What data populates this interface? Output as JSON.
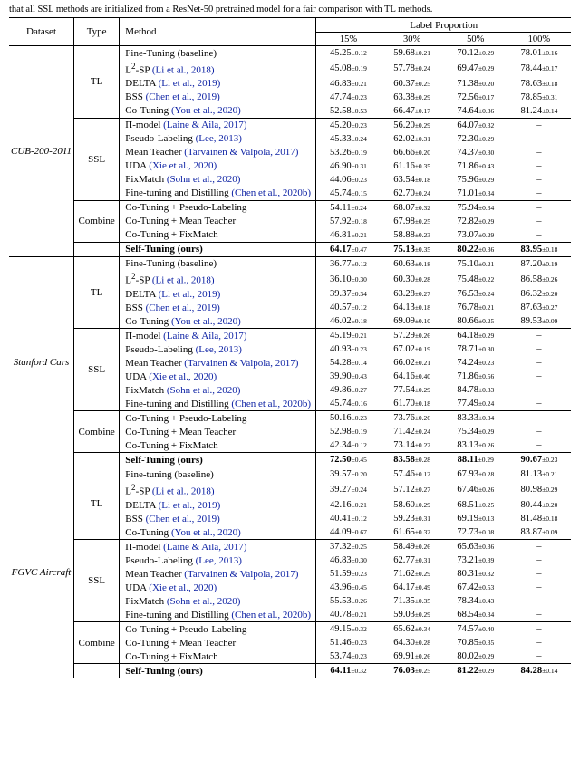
{
  "caption": "that all SSL methods are initialized from a ResNet-50 pretrained model for a fair comparison with TL methods.",
  "hdr": {
    "dataset": "Dataset",
    "type": "Type",
    "method": "Method",
    "lp": "Label Proportion",
    "p15": "15%",
    "p30": "30%",
    "p50": "50%",
    "p100": "100%"
  },
  "chart_data": {
    "type": "table",
    "datasets": [
      {
        "name": "CUB-200-2011",
        "groups": [
          {
            "type": "TL",
            "rows": [
              {
                "method": "Fine-Tuning (baseline)",
                "cite": "",
                "v": [
                  "45.25±0.12",
                  "59.68±0.21",
                  "70.12±0.29",
                  "78.01±0.16"
                ]
              },
              {
                "method": "L²-SP ",
                "cite": "(Li et al., 2018)",
                "v": [
                  "45.08±0.19",
                  "57.78±0.24",
                  "69.47±0.29",
                  "78.44±0.17"
                ]
              },
              {
                "method": "DELTA ",
                "cite": "(Li et al., 2019)",
                "v": [
                  "46.83±0.21",
                  "60.37±0.25",
                  "71.38±0.20",
                  "78.63±0.18"
                ]
              },
              {
                "method": "BSS ",
                "cite": "(Chen et al., 2019)",
                "v": [
                  "47.74±0.23",
                  "63.38±0.29",
                  "72.56±0.17",
                  "78.85±0.31"
                ]
              },
              {
                "method": "Co-Tuning ",
                "cite": "(You et al., 2020)",
                "v": [
                  "52.58±0.53",
                  "66.47±0.17",
                  "74.64±0.36",
                  "81.24±0.14"
                ]
              }
            ]
          },
          {
            "type": "SSL",
            "rows": [
              {
                "method": "Π-model ",
                "cite": "(Laine & Aila, 2017)",
                "v": [
                  "45.20±0.23",
                  "56.20±0.29",
                  "64.07±0.32",
                  "–"
                ]
              },
              {
                "method": "Pseudo-Labeling ",
                "cite": "(Lee, 2013)",
                "v": [
                  "45.33±0.24",
                  "62.02±0.31",
                  "72.30±0.29",
                  "–"
                ]
              },
              {
                "method": "Mean Teacher ",
                "cite": "(Tarvainen & Valpola, 2017)",
                "v": [
                  "53.26±0.19",
                  "66.66±0.20",
                  "74.37±0.30",
                  "–"
                ]
              },
              {
                "method": "UDA ",
                "cite": "(Xie et al., 2020)",
                "v": [
                  "46.90±0.31",
                  "61.16±0.35",
                  "71.86±0.43",
                  "–"
                ]
              },
              {
                "method": "FixMatch ",
                "cite": "(Sohn et al., 2020)",
                "v": [
                  "44.06±0.23",
                  "63.54±0.18",
                  "75.96±0.29",
                  "–"
                ]
              },
              {
                "method": "Fine-tuning and Distilling  ",
                "cite": "(Chen et al., 2020b)",
                "v": [
                  "45.74±0.15",
                  "62.70±0.24",
                  "71.01±0.34",
                  "–"
                ]
              }
            ]
          },
          {
            "type": "Combine",
            "rows": [
              {
                "method": "Co-Tuning + Pseudo-Labeling",
                "cite": "",
                "v": [
                  "54.11±0.24",
                  "68.07±0.32",
                  "75.94±0.34",
                  "–"
                ]
              },
              {
                "method": "Co-Tuning + Mean Teacher",
                "cite": "",
                "v": [
                  "57.92±0.18",
                  "67.98±0.25",
                  "72.82±0.29",
                  "–"
                ]
              },
              {
                "method": "Co-Tuning + FixMatch",
                "cite": "",
                "v": [
                  "46.81±0.21",
                  "58.88±0.23",
                  "73.07±0.29",
                  "–"
                ]
              }
            ]
          },
          {
            "type": "",
            "rows": [
              {
                "method": "Self-Tuning (ours)",
                "cite": "",
                "bold": true,
                "v": [
                  "64.17±0.47",
                  "75.13±0.35",
                  "80.22±0.36",
                  "83.95±0.18"
                ]
              }
            ]
          }
        ]
      },
      {
        "name": "Stanford Cars",
        "groups": [
          {
            "type": "TL",
            "rows": [
              {
                "method": "Fine-Tuning (baseline)",
                "cite": "",
                "v": [
                  "36.77±0.12",
                  "60.63±0.18",
                  "75.10±0.21",
                  "87.20±0.19"
                ]
              },
              {
                "method": "L²-SP ",
                "cite": "(Li et al., 2018)",
                "v": [
                  "36.10±0.30",
                  "60.30±0.28",
                  "75.48±0.22",
                  "86.58±0.26"
                ]
              },
              {
                "method": "DELTA ",
                "cite": "(Li et al., 2019)",
                "v": [
                  "39.37±0.34",
                  "63.28±0.27",
                  "76.53±0.24",
                  "86.32±0.20"
                ]
              },
              {
                "method": "BSS ",
                "cite": "(Chen et al., 2019)",
                "v": [
                  "40.57±0.12",
                  "64.13±0.18",
                  "76.78±0.21",
                  "87.63±0.27"
                ]
              },
              {
                "method": "Co-Tuning ",
                "cite": "(You et al., 2020)",
                "v": [
                  "46.02±0.18",
                  "69.09±0.10",
                  "80.66±0.25",
                  "89.53±0.09"
                ]
              }
            ]
          },
          {
            "type": "SSL",
            "rows": [
              {
                "method": "Π-model ",
                "cite": "(Laine & Aila, 2017)",
                "v": [
                  "45.19±0.21",
                  "57.29±0.26",
                  "64.18±0.29",
                  "–"
                ]
              },
              {
                "method": "Pseudo-Labeling ",
                "cite": "(Lee, 2013)",
                "v": [
                  "40.93±0.23",
                  "67.02±0.19",
                  "78.71±0.30",
                  "–"
                ]
              },
              {
                "method": "Mean Teacher ",
                "cite": "(Tarvainen & Valpola, 2017)",
                "v": [
                  "54.28±0.14",
                  "66.02±0.21",
                  "74.24±0.23",
                  "–"
                ]
              },
              {
                "method": "UDA ",
                "cite": "(Xie et al., 2020)",
                "v": [
                  "39.90±0.43",
                  "64.16±0.40",
                  "71.86±0.56",
                  "–"
                ]
              },
              {
                "method": "FixMatch ",
                "cite": "(Sohn et al., 2020)",
                "v": [
                  "49.86±0.27",
                  "77.54±0.29",
                  "84.78±0.33",
                  "–"
                ]
              },
              {
                "method": "Fine-tuning and Distilling  ",
                "cite": "(Chen et al., 2020b)",
                "v": [
                  "45.74±0.16",
                  "61.70±0.18",
                  "77.49±0.24",
                  "–"
                ]
              }
            ]
          },
          {
            "type": "Combine",
            "rows": [
              {
                "method": "Co-Tuning + Pseudo-Labeling",
                "cite": "",
                "v": [
                  "50.16±0.23",
                  "73.76±0.26",
                  "83.33±0.34",
                  "–"
                ]
              },
              {
                "method": "Co-Tuning + Mean Teacher",
                "cite": "",
                "v": [
                  "52.98±0.19",
                  "71.42±0.24",
                  "75.34±0.29",
                  "–"
                ]
              },
              {
                "method": "Co-Tuning + FixMatch",
                "cite": "",
                "v": [
                  "42.34±0.12",
                  "73.14±0.22",
                  "83.13±0.26",
                  "–"
                ]
              }
            ]
          },
          {
            "type": "",
            "rows": [
              {
                "method": "Self-Tuning (ours)",
                "cite": "",
                "bold": true,
                "v": [
                  "72.50±0.45",
                  "83.58±0.28",
                  "88.11±0.29",
                  "90.67±0.23"
                ]
              }
            ]
          }
        ]
      },
      {
        "name": "FGVC Aircraft",
        "groups": [
          {
            "type": "TL",
            "rows": [
              {
                "method": "Fine-tuning (baseline)",
                "cite": "",
                "v": [
                  "39.57±0.20",
                  "57.46±0.12",
                  "67.93±0.28",
                  "81.13±0.21"
                ]
              },
              {
                "method": "L²-SP ",
                "cite": "(Li et al., 2018)",
                "v": [
                  "39.27±0.24",
                  "57.12±0.27",
                  "67.46±0.26",
                  "80.98±0.29"
                ]
              },
              {
                "method": "DELTA ",
                "cite": "(Li et al., 2019)",
                "v": [
                  "42.16±0.21",
                  "58.60±0.29",
                  "68.51±0.25",
                  "80.44±0.20"
                ]
              },
              {
                "method": "BSS ",
                "cite": "(Chen et al., 2019)",
                "v": [
                  "40.41±0.12",
                  "59.23±0.31",
                  "69.19±0.13",
                  "81.48±0.18"
                ]
              },
              {
                "method": "Co-Tuning ",
                "cite": "(You et al., 2020)",
                "v": [
                  "44.09±0.67",
                  "61.65±0.32",
                  "72.73±0.08",
                  "83.87±0.09"
                ]
              }
            ]
          },
          {
            "type": "SSL",
            "rows": [
              {
                "method": "Π-model ",
                "cite": "(Laine & Aila, 2017)",
                "v": [
                  "37.32±0.25",
                  "58.49±0.26",
                  "65.63±0.36",
                  "–"
                ]
              },
              {
                "method": "Pseudo-Labeling ",
                "cite": "(Lee, 2013)",
                "v": [
                  "46.83±0.30",
                  "62.77±0.31",
                  "73.21±0.39",
                  "–"
                ]
              },
              {
                "method": "Mean Teacher ",
                "cite": "(Tarvainen & Valpola, 2017)",
                "v": [
                  "51.59±0.23",
                  "71.62±0.29",
                  "80.31±0.32",
                  "–"
                ]
              },
              {
                "method": "UDA ",
                "cite": "(Xie et al., 2020)",
                "v": [
                  "43.96±0.45",
                  "64.17±0.49",
                  "67.42±0.53",
                  "–"
                ]
              },
              {
                "method": "FixMatch ",
                "cite": "(Sohn et al., 2020)",
                "v": [
                  "55.53±0.26",
                  "71.35±0.35",
                  "78.34±0.43",
                  "–"
                ]
              },
              {
                "method": "Fine-tuning and Distilling  ",
                "cite": "(Chen et al., 2020b)",
                "v": [
                  "40.78±0.21",
                  "59.03±0.29",
                  "68.54±0.34",
                  "–"
                ]
              }
            ]
          },
          {
            "type": "Combine",
            "rows": [
              {
                "method": "Co-Tuning + Pseudo-Labeling",
                "cite": "",
                "v": [
                  "49.15±0.32",
                  "65.62±0.34",
                  "74.57±0.40",
                  "–"
                ]
              },
              {
                "method": "Co-Tuning + Mean Teacher",
                "cite": "",
                "v": [
                  "51.46±0.23",
                  "64.30±0.28",
                  "70.85±0.35",
                  "–"
                ]
              },
              {
                "method": "Co-Tuning + FixMatch",
                "cite": "",
                "v": [
                  "53.74±0.23",
                  "69.91±0.26",
                  "80.02±0.29",
                  "–"
                ]
              }
            ]
          },
          {
            "type": "",
            "rows": [
              {
                "method": "Self-Tuning (ours)",
                "cite": "",
                "bold": true,
                "v": [
                  "64.11±0.32",
                  "76.03±0.25",
                  "81.22±0.29",
                  "84.28±0.14"
                ]
              }
            ]
          }
        ]
      }
    ]
  }
}
